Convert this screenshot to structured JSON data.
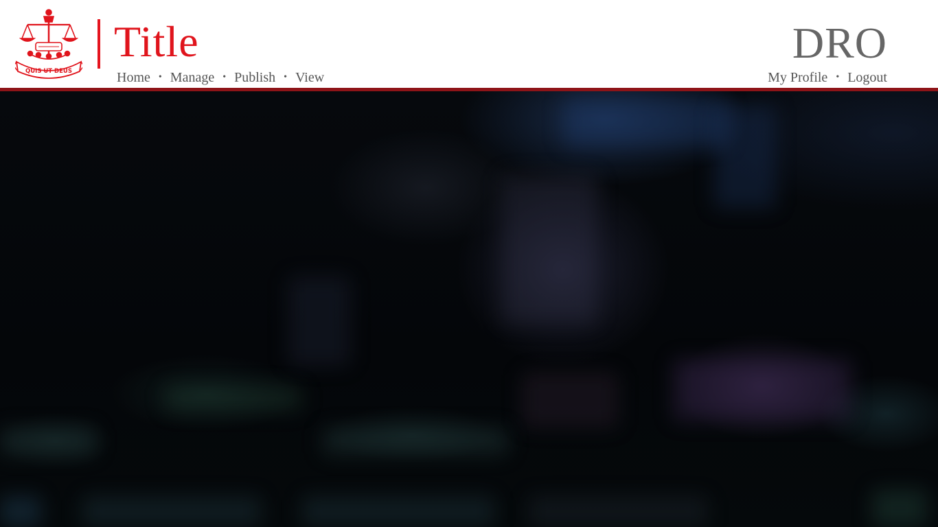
{
  "header": {
    "logo": {
      "motto": "QUIS UT DEUS",
      "color": "#e0141c"
    },
    "title": "Title",
    "brand": "DRO",
    "nav": [
      {
        "label": "Home"
      },
      {
        "label": "Manage"
      },
      {
        "label": "Publish"
      },
      {
        "label": "View"
      }
    ],
    "separator": "•",
    "user_nav": [
      {
        "label": "My Profile"
      },
      {
        "label": "Logout"
      }
    ]
  },
  "colors": {
    "accent": "#e0141c",
    "rule": "#8e1418",
    "nav_text": "#555555",
    "brand_text": "#666666",
    "background": "#05080b"
  }
}
